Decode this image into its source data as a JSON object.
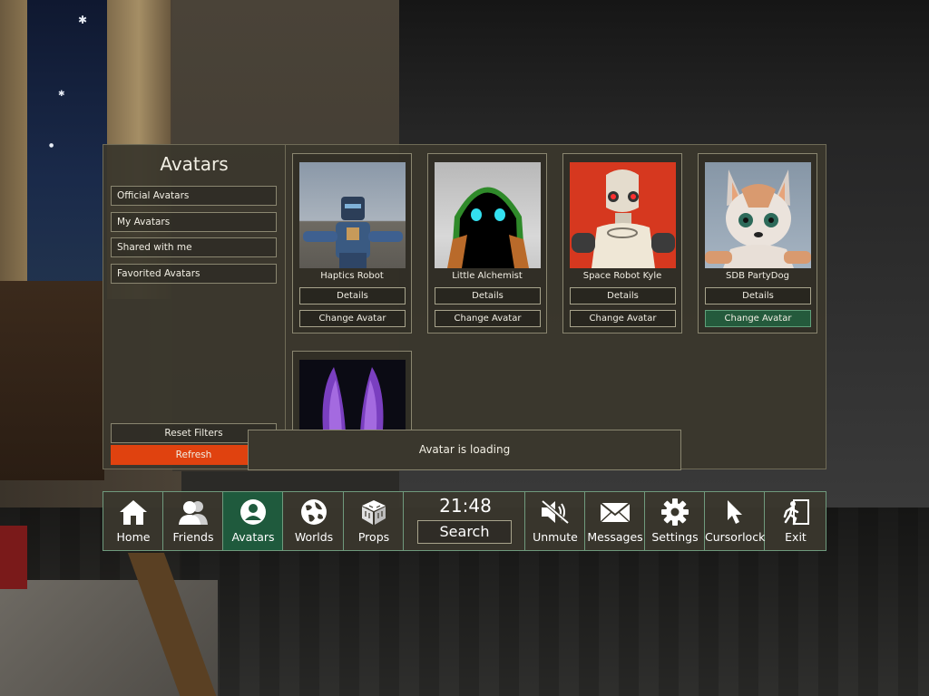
{
  "sidebar": {
    "title": "Avatars",
    "filters": [
      "Official Avatars",
      "My Avatars",
      "Shared with me",
      "Favorited Avatars"
    ],
    "reset_label": "Reset Filters",
    "refresh_label": "Refresh"
  },
  "avatars": [
    {
      "name": "Haptics Robot",
      "details_label": "Details",
      "change_label": "Change Avatar"
    },
    {
      "name": "Little Alchemist",
      "details_label": "Details",
      "change_label": "Change Avatar"
    },
    {
      "name": "Space Robot Kyle",
      "details_label": "Details",
      "change_label": "Change Avatar"
    },
    {
      "name": "SDB PartyDog",
      "details_label": "Details",
      "change_label": "Change Avatar"
    }
  ],
  "loading_message": "Avatar is loading",
  "menu": {
    "items": [
      {
        "label": "Home",
        "icon": "home-icon"
      },
      {
        "label": "Friends",
        "icon": "friends-icon"
      },
      {
        "label": "Avatars",
        "icon": "avatar-icon"
      },
      {
        "label": "Worlds",
        "icon": "globe-icon"
      },
      {
        "label": "Props",
        "icon": "cube-icon"
      }
    ],
    "clock": "21:48",
    "search_label": "Search",
    "right_items": [
      {
        "label": "Unmute",
        "icon": "muted-speaker-icon"
      },
      {
        "label": "Messages",
        "icon": "envelope-icon"
      },
      {
        "label": "Settings",
        "icon": "gear-icon"
      },
      {
        "label": "Cursorlock",
        "icon": "cursor-icon"
      },
      {
        "label": "Exit",
        "icon": "exit-icon"
      }
    ]
  },
  "colors": {
    "accent_active": "#1f5a3d",
    "refresh_button": "#e0420f",
    "panel_bg": "#3a372d"
  }
}
